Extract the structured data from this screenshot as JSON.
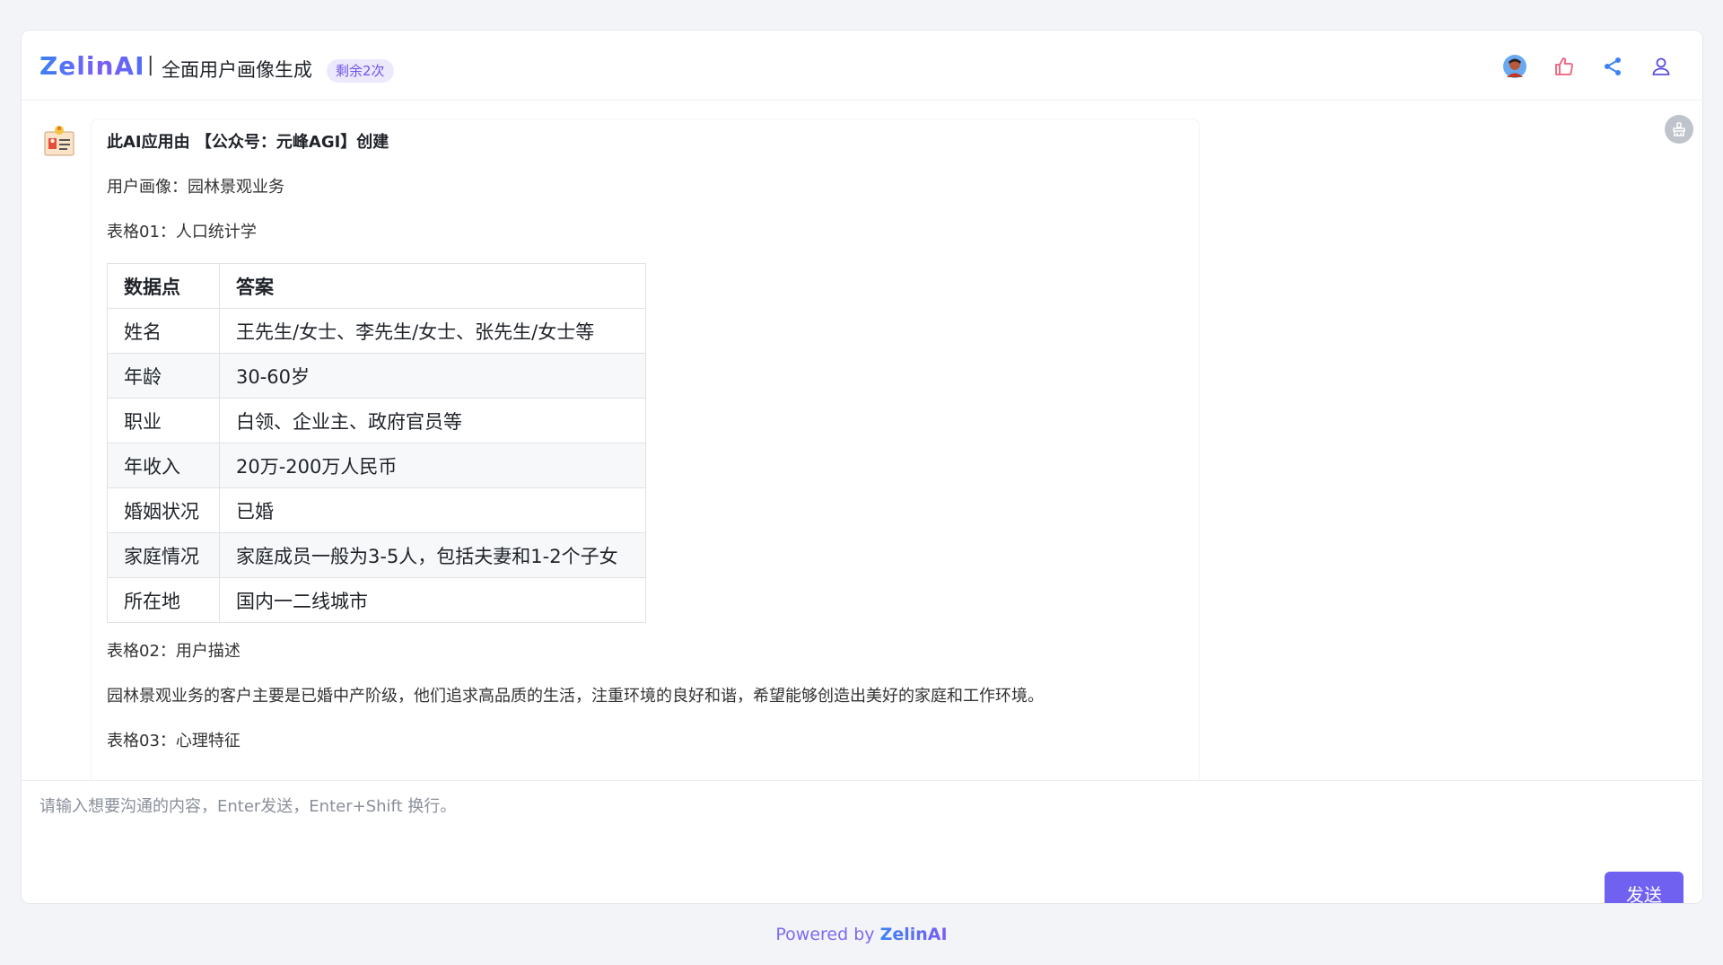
{
  "header": {
    "logo": "ZelinAI",
    "separator": "|",
    "app_title": "全面用户画像生成",
    "badge": "剩余2次"
  },
  "message": {
    "intro": "此AI应用由 【公众号：元峰AGI】创建",
    "persona": "用户画像：园林景观业务",
    "table1_title": "表格01：人口统计学",
    "table1": {
      "headers": [
        "数据点",
        "答案"
      ],
      "rows": [
        [
          "姓名",
          "王先生/女士、李先生/女士、张先生/女士等"
        ],
        [
          "年龄",
          "30-60岁"
        ],
        [
          "职业",
          "白领、企业主、政府官员等"
        ],
        [
          "年收入",
          "20万-200万人民币"
        ],
        [
          "婚姻状况",
          "已婚"
        ],
        [
          "家庭情况",
          "家庭成员一般为3-5人，包括夫妻和1-2个子女"
        ],
        [
          "所在地",
          "国内一二线城市"
        ]
      ]
    },
    "table2_title": "表格02：用户描述",
    "table2_text": "园林景观业务的客户主要是已婚中产阶级，他们追求高品质的生活，注重环境的良好和谐，希望能够创造出美好的家庭和工作环境。",
    "table3_title": "表格03：心理特征"
  },
  "composer": {
    "placeholder": "请输入想要沟通的内容，Enter发送，Enter+Shift 换行。",
    "value": "",
    "send_label": "发送"
  },
  "footer": {
    "powered_by": "Powered by",
    "brand": "ZelinAI"
  },
  "icons": {
    "user_avatar": "user-avatar",
    "like": "thumbs-up-icon",
    "share": "share-icon",
    "account": "person-icon",
    "clear": "broom-icon"
  },
  "colors": {
    "accent": "#7061f0",
    "like": "#f25c7a",
    "share": "#3b82f6",
    "account": "#5b4fe0"
  }
}
